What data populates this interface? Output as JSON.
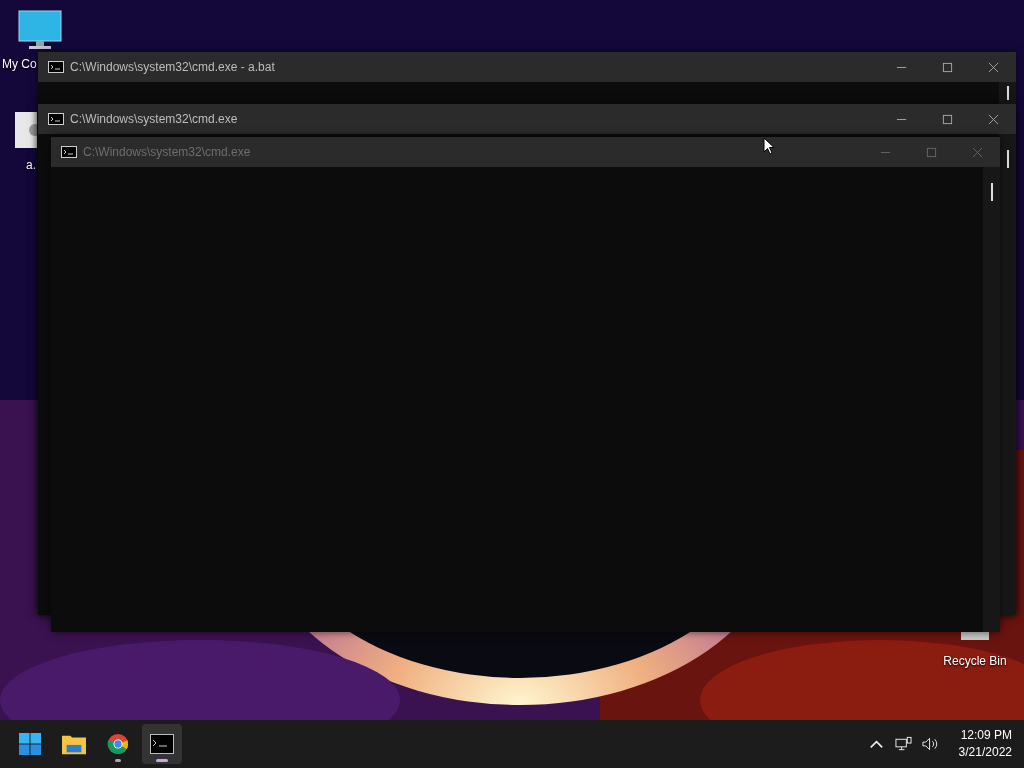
{
  "desktop": {
    "icons": [
      {
        "kind": "computer",
        "label": "My Co"
      },
      {
        "kind": "file",
        "label": "a."
      },
      {
        "kind": "bin",
        "label": "Recycle Bin"
      }
    ]
  },
  "windows": [
    {
      "title": "C:\\Windows\\system32\\cmd.exe - a.bat",
      "dimmed": false
    },
    {
      "title": "C:\\Windows\\system32\\cmd.exe",
      "dimmed": false
    },
    {
      "title": "C:\\Windows\\system32\\cmd.exe",
      "dimmed": true
    }
  ],
  "taskbar": {
    "apps": [
      {
        "kind": "start",
        "running": false,
        "selected": false
      },
      {
        "kind": "explorer",
        "running": false,
        "selected": false
      },
      {
        "kind": "chrome",
        "running": true,
        "selected": false
      },
      {
        "kind": "terminal",
        "running": true,
        "selected": true
      }
    ],
    "clock": {
      "time": "12:09 PM",
      "date": "3/21/2022"
    }
  }
}
